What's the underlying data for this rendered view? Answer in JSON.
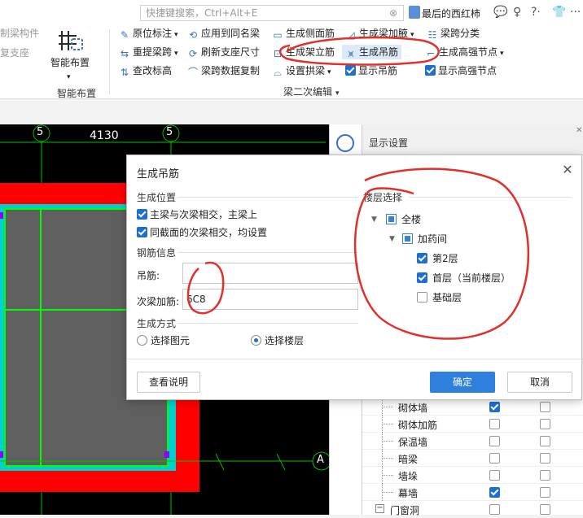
{
  "topbar": {
    "search_placeholder": "快捷键搜索，Ctrl+Alt+E",
    "user_name": "最后的西红柿"
  },
  "ribbon": {
    "left_gray_1": "制梁构件",
    "left_gray_2": "复支座",
    "smart_layout": "智能布置",
    "smart_layout_group": "智能布置",
    "col1": [
      "原位标注",
      "重提梁跨",
      "查改标高"
    ],
    "col2": [
      "应用到同名梁",
      "刷新支座尺寸",
      "梁跨数据复制"
    ],
    "col3": [
      "生成侧面筋",
      "生成架立筋",
      "设置拱梁"
    ],
    "col4": [
      "生成梁加腋",
      "生成吊筋",
      "显示吊筋"
    ],
    "col5": [
      "梁跨分类",
      "生成高强节点",
      "显示高强节点"
    ],
    "group_label": "梁二次编辑"
  },
  "canvas": {
    "axis_5_left": "5",
    "axis_5_right": "5",
    "dimension": "4130",
    "axis_a": "A"
  },
  "right_panel": {
    "title": "显示设置",
    "rows": [
      {
        "label": "砌体墙",
        "c1": true,
        "c2": false
      },
      {
        "label": "砌体加筋",
        "c1": false,
        "c2": false
      },
      {
        "label": "保温墙",
        "c1": false,
        "c2": false
      },
      {
        "label": "暗梁",
        "c1": false,
        "c2": false
      },
      {
        "label": "墙垛",
        "c1": false,
        "c2": false
      },
      {
        "label": "幕墙",
        "c1": true,
        "c2": false
      }
    ],
    "last_group": "门窗洞"
  },
  "dialog": {
    "title": "生成吊筋",
    "position_section": "生成位置",
    "pos_opt1": "主梁与次梁相交，主梁上",
    "pos_opt2": "同截面的次梁相交，均设置",
    "rebar_section": "钢筋信息",
    "hanger_label": "吊筋:",
    "hanger_value": "",
    "stirrup_label": "次梁加筋:",
    "stirrup_value": "6C8",
    "method_section": "生成方式",
    "method_opt1": "选择图元",
    "method_opt2": "选择楼层",
    "floor_section": "楼层选择",
    "floor_tree": {
      "all": "全楼",
      "group": "加药间",
      "floor2": "第2层",
      "floor1": "首层（当前楼层）",
      "base": "基础层"
    },
    "help_button": "查看说明",
    "ok_button": "确定",
    "cancel_button": "取消"
  },
  "colors": {
    "accent": "#2f7fdc",
    "annotation": "#e0302c",
    "beam_red": "#ff0000",
    "canvas_bg": "#000000"
  }
}
